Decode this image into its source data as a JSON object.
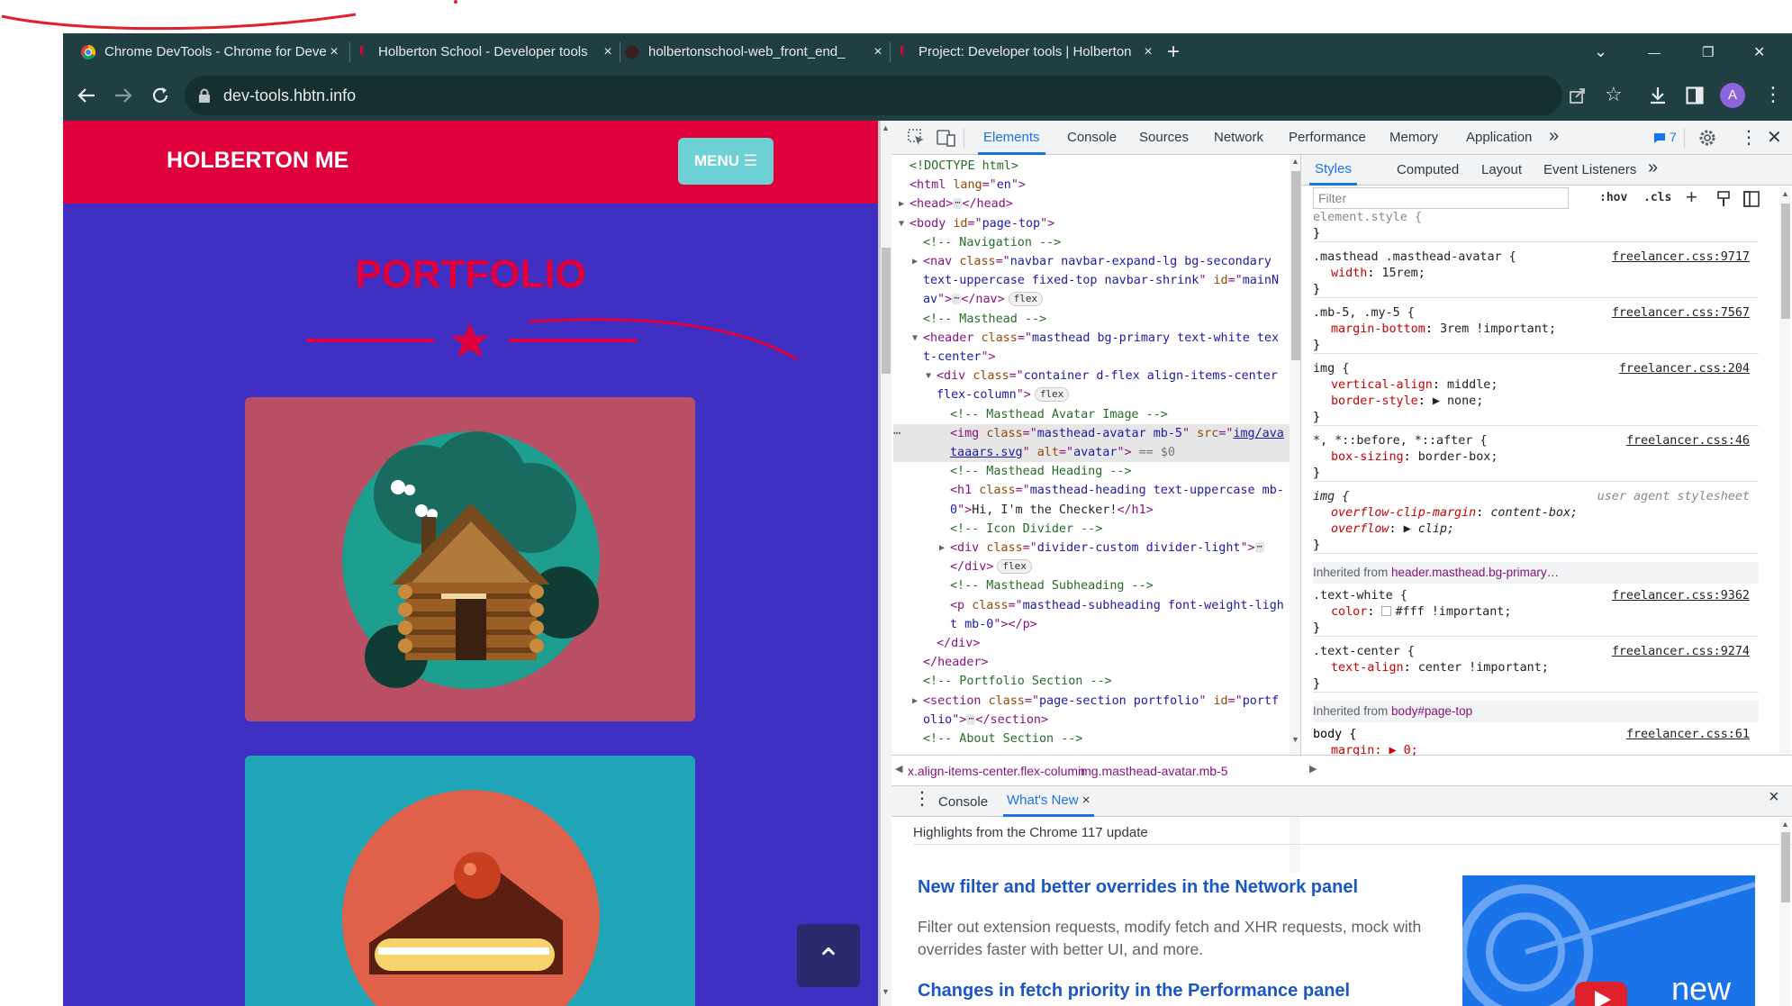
{
  "browser": {
    "tabs": [
      {
        "title": "Chrome DevTools - Chrome for Developers",
        "close": "×"
      },
      {
        "title": "Holberton School - Developer tools",
        "close": "×"
      },
      {
        "title": "holbertonschool-web_front_end_",
        "close": "×"
      },
      {
        "title": "Project: Developer tools | Holberton",
        "close": "×"
      }
    ],
    "new_tab": "+",
    "url": "dev-tools.hbtn.info",
    "profile_initial": "A",
    "window_controls": {
      "dropdown": "⌄",
      "minimize": "—",
      "restore": "❐",
      "close": "✕"
    }
  },
  "site": {
    "brand": "HOLBERTON ME",
    "menu_label": "MENU ☰",
    "section_title": "PORTFOLIO",
    "scroll_top": "⌃",
    "colors": {
      "nav": "#e0003c",
      "bg": "#3f2fc2",
      "card1": "#b94f65",
      "card2": "#20a4b8",
      "accent": "#e0003c",
      "menu_btn": "#6dd0d3"
    }
  },
  "devtools": {
    "tabs": [
      "Elements",
      "Console",
      "Sources",
      "Network",
      "Performance",
      "Memory",
      "Application"
    ],
    "more": "»",
    "issues_count": "7",
    "elements": [
      {
        "indent": 0,
        "parts": [
          [
            "c",
            "<!DOCTYPE html>"
          ]
        ]
      },
      {
        "indent": 0,
        "parts": [
          [
            "t",
            "<html "
          ],
          [
            "a",
            "lang"
          ],
          [
            "t",
            "=\""
          ],
          [
            "v",
            "en"
          ],
          [
            "t",
            "\">"
          ]
        ]
      },
      {
        "indent": 0,
        "arrow": "▶",
        "parts": [
          [
            "t",
            "<head>"
          ],
          [
            "dots",
            "⋯"
          ],
          [
            "t",
            "</head>"
          ]
        ]
      },
      {
        "indent": 0,
        "arrow": "▼",
        "parts": [
          [
            "t",
            "<body "
          ],
          [
            "a",
            "id"
          ],
          [
            "t",
            "=\""
          ],
          [
            "v",
            "page-top"
          ],
          [
            "t",
            "\">"
          ]
        ]
      },
      {
        "indent": 1,
        "parts": [
          [
            "c",
            "<!-- Navigation -->"
          ]
        ]
      },
      {
        "indent": 1,
        "arrow": "▶",
        "parts": [
          [
            "t",
            "<nav "
          ],
          [
            "a",
            "class"
          ],
          [
            "t",
            "=\""
          ],
          [
            "v",
            "navbar navbar-expand-lg bg-secondary"
          ]
        ]
      },
      {
        "indent": 1,
        "parts": [
          [
            "v",
            "text-uppercase fixed-top navbar-shrink"
          ],
          [
            "t",
            "\" "
          ],
          [
            "a",
            "id"
          ],
          [
            "t",
            "=\""
          ],
          [
            "v",
            "mainN"
          ]
        ]
      },
      {
        "indent": 1,
        "parts": [
          [
            "v",
            "av"
          ],
          [
            "t",
            "\">"
          ],
          [
            "dots",
            "⋯"
          ],
          [
            "t",
            "</nav>"
          ],
          [
            "pill",
            "flex"
          ]
        ]
      },
      {
        "indent": 1,
        "parts": [
          [
            "c",
            "<!-- Masthead -->"
          ]
        ]
      },
      {
        "indent": 1,
        "arrow": "▼",
        "parts": [
          [
            "t",
            "<header "
          ],
          [
            "a",
            "class"
          ],
          [
            "t",
            "=\""
          ],
          [
            "v",
            "masthead bg-primary text-white tex"
          ]
        ]
      },
      {
        "indent": 1,
        "parts": [
          [
            "v",
            "t-center"
          ],
          [
            "t",
            "\">"
          ]
        ]
      },
      {
        "indent": 2,
        "arrow": "▼",
        "parts": [
          [
            "t",
            "<div "
          ],
          [
            "a",
            "class"
          ],
          [
            "t",
            "=\""
          ],
          [
            "v",
            "container d-flex align-items-center"
          ]
        ]
      },
      {
        "indent": 2,
        "parts": [
          [
            "v",
            "flex-column"
          ],
          [
            "t",
            "\">"
          ],
          [
            "pill",
            "flex"
          ]
        ]
      },
      {
        "indent": 3,
        "parts": [
          [
            "c",
            "<!-- Masthead Avatar Image -->"
          ]
        ]
      },
      {
        "indent": 3,
        "selected": true,
        "parts": [
          [
            "t",
            "<img "
          ],
          [
            "a",
            "class"
          ],
          [
            "t",
            "=\""
          ],
          [
            "v",
            "masthead-avatar mb-5"
          ],
          [
            "t",
            "\" "
          ],
          [
            "a",
            "src"
          ],
          [
            "t",
            "=\""
          ],
          [
            "u",
            "img/ava"
          ]
        ]
      },
      {
        "indent": 3,
        "selected": true,
        "parts": [
          [
            "u",
            "taaars.svg"
          ],
          [
            "t",
            "\" "
          ],
          [
            "a",
            "alt"
          ],
          [
            "t",
            "=\""
          ],
          [
            "v",
            "avatar"
          ],
          [
            "t",
            "\">"
          ],
          [
            "x",
            " == $0"
          ]
        ]
      },
      {
        "indent": 3,
        "parts": [
          [
            "c",
            "<!-- Masthead Heading -->"
          ]
        ]
      },
      {
        "indent": 3,
        "parts": [
          [
            "t",
            "<h1 "
          ],
          [
            "a",
            "class"
          ],
          [
            "t",
            "=\""
          ],
          [
            "v",
            "masthead-heading text-uppercase mb-"
          ]
        ]
      },
      {
        "indent": 3,
        "parts": [
          [
            "v",
            "0"
          ],
          [
            "t",
            "\">"
          ],
          [
            "p",
            "Hi, I'm the Checker!"
          ],
          [
            "t",
            "</h1>"
          ]
        ]
      },
      {
        "indent": 3,
        "parts": [
          [
            "c",
            "<!-- Icon Divider -->"
          ]
        ]
      },
      {
        "indent": 3,
        "arrow": "▶",
        "parts": [
          [
            "t",
            "<div "
          ],
          [
            "a",
            "class"
          ],
          [
            "t",
            "=\""
          ],
          [
            "v",
            "divider-custom divider-light"
          ],
          [
            "t",
            "\">"
          ],
          [
            "dots",
            "⋯"
          ]
        ]
      },
      {
        "indent": 3,
        "parts": [
          [
            "t",
            "</div>"
          ],
          [
            "pill",
            "flex"
          ]
        ]
      },
      {
        "indent": 3,
        "parts": [
          [
            "c",
            "<!-- Masthead Subheading -->"
          ]
        ]
      },
      {
        "indent": 3,
        "parts": [
          [
            "t",
            "<p "
          ],
          [
            "a",
            "class"
          ],
          [
            "t",
            "=\""
          ],
          [
            "v",
            "masthead-subheading font-weight-ligh"
          ]
        ]
      },
      {
        "indent": 3,
        "parts": [
          [
            "v",
            "t mb-0"
          ],
          [
            "t",
            "\"></p>"
          ]
        ]
      },
      {
        "indent": 2,
        "parts": [
          [
            "t",
            "</div>"
          ]
        ]
      },
      {
        "indent": 1,
        "parts": [
          [
            "t",
            "</header>"
          ]
        ]
      },
      {
        "indent": 1,
        "parts": [
          [
            "c",
            "<!-- Portfolio Section -->"
          ]
        ]
      },
      {
        "indent": 1,
        "arrow": "▶",
        "parts": [
          [
            "t",
            "<section "
          ],
          [
            "a",
            "class"
          ],
          [
            "t",
            "=\""
          ],
          [
            "v",
            "page-section portfolio"
          ],
          [
            "t",
            "\" "
          ],
          [
            "a",
            "id"
          ],
          [
            "t",
            "=\""
          ],
          [
            "v",
            "portf"
          ]
        ]
      },
      {
        "indent": 1,
        "parts": [
          [
            "v",
            "olio"
          ],
          [
            "t",
            "\">"
          ],
          [
            "dots",
            "⋯"
          ],
          [
            "t",
            "</section>"
          ]
        ]
      },
      {
        "indent": 1,
        "parts": [
          [
            "c",
            "<!-- About Section -->"
          ]
        ]
      }
    ],
    "breadcrumbs": [
      "x.align-items-center.flex-column",
      "img.masthead-avatar.mb-5"
    ],
    "styles_tabs": [
      "Styles",
      "Computed",
      "Layout",
      "Event Listeners"
    ],
    "filter_placeholder": "Filter",
    "hov": ":hov",
    "cls": ".cls",
    "rules": [
      {
        "selector": "element.style {",
        "source": "",
        "decls": [],
        "close": "}",
        "grey": true
      },
      {
        "selector": ".masthead .masthead-avatar {",
        "source": "freelancer.css:9717",
        "decls": [
          [
            "width",
            "15rem;"
          ]
        ],
        "close": "}"
      },
      {
        "selector": ".mb-5, .my-5 {",
        "source": "freelancer.css:7567",
        "decls": [
          [
            "margin-bottom",
            "3rem !important;"
          ]
        ],
        "close": "}"
      },
      {
        "selector": "img {",
        "source": "freelancer.css:204",
        "decls": [
          [
            "vertical-align",
            "middle;"
          ],
          [
            "border-style",
            "▶ none;"
          ]
        ],
        "close": "}"
      },
      {
        "selector": "*, *::before, *::after {",
        "source": "freelancer.css:46",
        "decls": [
          [
            "box-sizing",
            "border-box;"
          ]
        ],
        "close": "}"
      },
      {
        "selector": "img {",
        "source": "user agent stylesheet",
        "decls": [
          [
            "overflow-clip-margin",
            "content-box;"
          ],
          [
            "overflow",
            "▶ clip;"
          ]
        ],
        "close": "}",
        "ua": true
      }
    ],
    "inherited1_label": "Inherited from ",
    "inherited1_selector": "header.masthead.bg-primary…",
    "rules2": [
      {
        "selector": ".text-white {",
        "source": "freelancer.css:9362",
        "decls": [
          [
            "color",
            "#fff !important;"
          ]
        ],
        "close": "}"
      },
      {
        "selector": ".text-center {",
        "source": "freelancer.css:9274",
        "decls": [
          [
            "text-align",
            "center !important;"
          ]
        ],
        "close": "}"
      }
    ],
    "inherited2_label": "Inherited from ",
    "inherited2_selector": "body#page-top",
    "body_rule": {
      "selector": "body {",
      "source": "freelancer.css:61",
      "decl": "margin: ▶ 0;"
    },
    "drawer": {
      "tabs": [
        "Console",
        "What's New"
      ],
      "close": "×",
      "highlights": "Highlights from the Chrome 117 update",
      "heading1": "New filter and better overrides in the Network panel",
      "body1": "Filter out extension requests, modify fetch and XHR requests, mock with overrides faster with better UI, and more.",
      "heading2": "Changes in fetch priority in the Performance panel",
      "video_badge": "new"
    }
  }
}
